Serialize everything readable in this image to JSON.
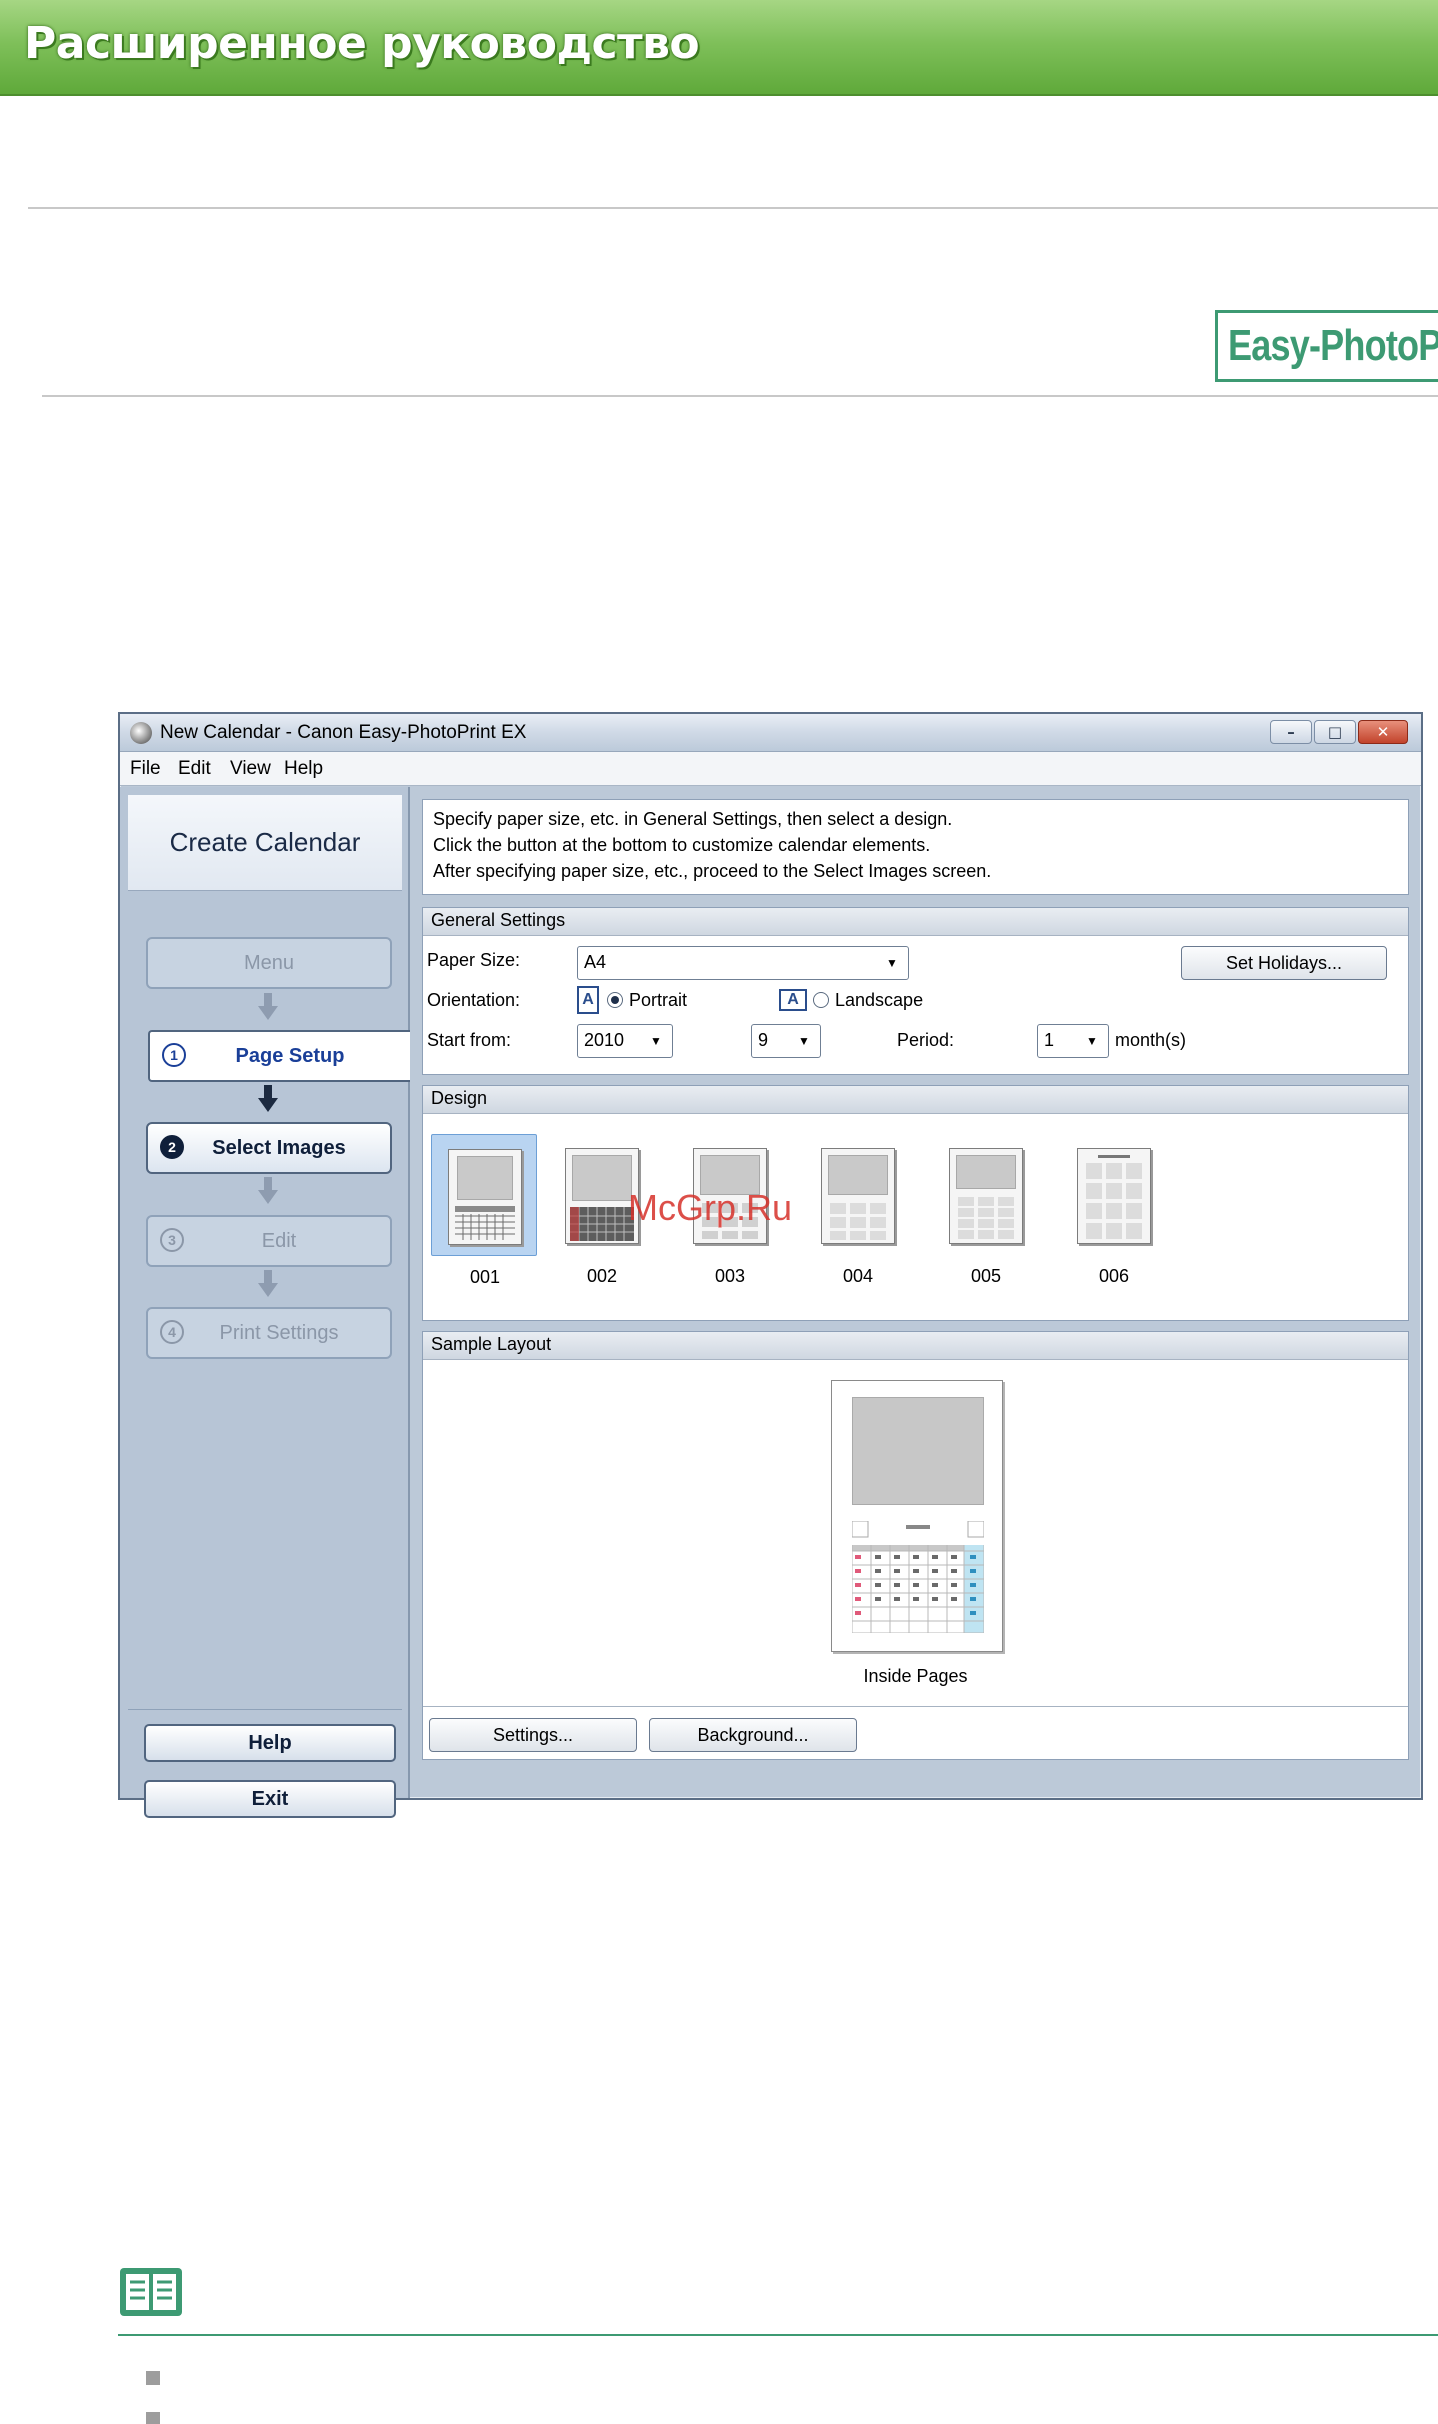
{
  "banner": {
    "title": "Расширенное руководство"
  },
  "app_logo": {
    "text": "Easy-PhotoP"
  },
  "window": {
    "title": "New Calendar - Canon Easy-PhotoPrint EX",
    "controls": {
      "minimize": "–",
      "maximize": "□",
      "close": "✕"
    },
    "menu": [
      "File",
      "Edit",
      "View",
      "Help"
    ]
  },
  "left_panel": {
    "title": "Create Calendar",
    "menu_button": "Menu",
    "steps": [
      {
        "num": "1",
        "label": "Page Setup",
        "state": "current"
      },
      {
        "num": "2",
        "label": "Select Images",
        "state": "enabled"
      },
      {
        "num": "3",
        "label": "Edit",
        "state": "disabled"
      },
      {
        "num": "4",
        "label": "Print Settings",
        "state": "disabled"
      }
    ],
    "help_button": "Help",
    "exit_button": "Exit"
  },
  "instructions": [
    "Specify paper size, etc. in General Settings, then select a design.",
    "Click the button at the bottom to customize calendar elements.",
    "After specifying paper size, etc., proceed to the Select Images screen."
  ],
  "general_settings": {
    "header": "General Settings",
    "paper_size_label": "Paper Size:",
    "paper_size_value": "A4",
    "set_holidays_button": "Set Holidays...",
    "orientation_label": "Orientation:",
    "portrait_icon_text": "A",
    "portrait_label": "Portrait",
    "landscape_icon_text": "A",
    "landscape_label": "Landscape",
    "orientation_selected": "Portrait",
    "start_from_label": "Start from:",
    "start_year": "2010",
    "start_month": "9",
    "period_label": "Period:",
    "period_value": "1",
    "period_unit": "month(s)"
  },
  "design": {
    "header": "Design",
    "items": [
      "001",
      "002",
      "003",
      "004",
      "005",
      "006"
    ],
    "selected": "001"
  },
  "sample_layout": {
    "header": "Sample Layout",
    "caption": "Inside Pages",
    "settings_button": "Settings...",
    "background_button": "Background..."
  },
  "watermark": "McGrp.Ru",
  "colors": {
    "banner_green": "#7fc05a",
    "accent_teal": "#3d9a73",
    "window_frame": "#5b6e86",
    "panel_blue": "#b7c5d6"
  },
  "icons": {
    "app": "canon-app-icon",
    "note": "note-book-icon",
    "bullet": "square-bullet-icon"
  }
}
